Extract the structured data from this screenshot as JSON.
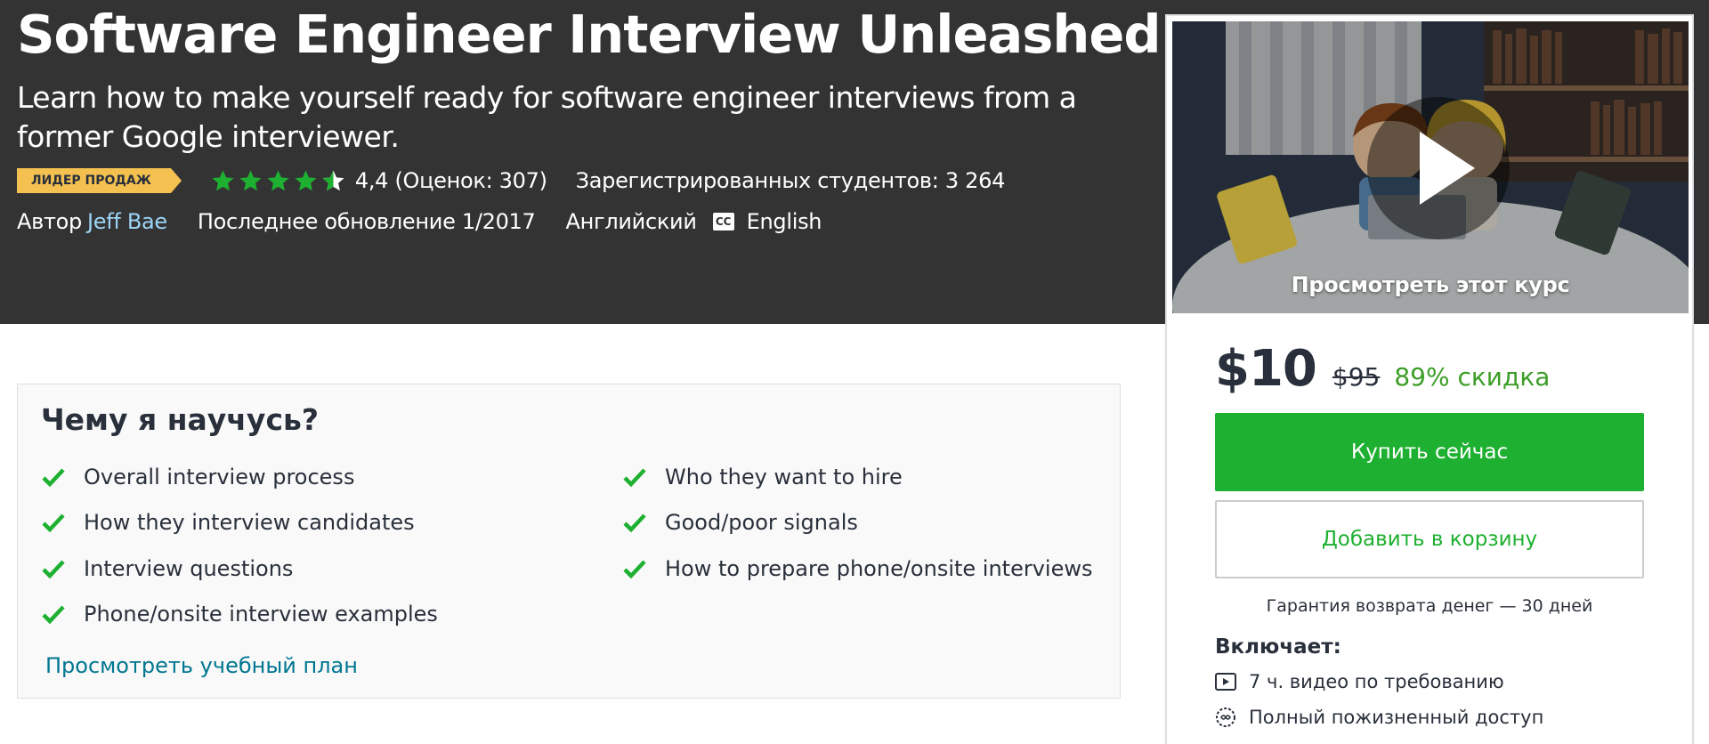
{
  "course": {
    "title": "Software Engineer Interview Unleashed",
    "subtitle": "Learn how to make yourself ready for software engineer interviews from a former Google interviewer.",
    "badge": "ЛИДЕР ПРОДАЖ",
    "rating_value": 4.4,
    "rating_text": "4,4 (Оценок: 307)",
    "students_text": "Зарегистрированных студентов: 3 264",
    "author_prefix": "Автор",
    "author_name": "Jeff Bae",
    "updated_text": "Последнее обновление 1/2017",
    "language": "Английский",
    "cc_label": "CC",
    "captions": "English"
  },
  "sidebar": {
    "preview_label": "Просмотреть этот курс",
    "price": "$10",
    "old_price": "$95",
    "discount": "89% скидка",
    "buy_label": "Купить сейчас",
    "cart_label": "Добавить в корзину",
    "guarantee": "Гарантия возврата денег — 30 дней",
    "includes_title": "Включает:",
    "includes": [
      {
        "icon": "video-icon",
        "text": "7 ч. видео по требованию"
      },
      {
        "icon": "lifetime-access-icon",
        "text": "Полный пожизненный доступ"
      }
    ]
  },
  "learn": {
    "title": "Чему я научусь?",
    "items_left": [
      "Overall interview process",
      "How they interview candidates",
      "Interview questions",
      "Phone/onsite interview examples"
    ],
    "items_right": [
      "Who they want to hire",
      "Good/poor signals",
      "How to prepare phone/onsite interviews"
    ],
    "curriculum_link": "Просмотреть учебный план"
  },
  "colors": {
    "hero_bg": "#333333",
    "badge": "#f4c150",
    "star": "#1eb030",
    "buy_button": "#1eb030",
    "link": "#007791",
    "author_link": "#9dd4f6",
    "discount": "#3b9e26"
  }
}
